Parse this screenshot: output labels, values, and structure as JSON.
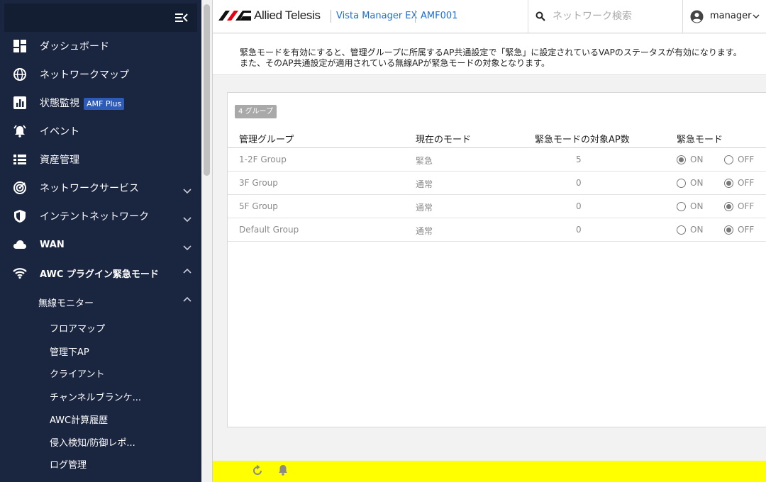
{
  "app": {
    "brand": "Allied Telesis",
    "product": "Vista Manager EX",
    "device": "AMF001"
  },
  "search": {
    "placeholder": "ネットワーク検索"
  },
  "user": {
    "name": "manager"
  },
  "sidebar": {
    "items": [
      {
        "label": "ダッシュボード",
        "icon": "dashboard-icon"
      },
      {
        "label": "ネットワークマップ",
        "icon": "globe-icon"
      },
      {
        "label": "状態監視",
        "icon": "chart-icon",
        "badge": "AMF Plus"
      },
      {
        "label": "イベント",
        "icon": "alarm-icon"
      },
      {
        "label": "資産管理",
        "icon": "list-icon"
      },
      {
        "label": "ネットワークサービス",
        "icon": "radar-icon",
        "expand": "down"
      },
      {
        "label": "インテントネットワーク",
        "icon": "shield-icon",
        "expand": "down"
      },
      {
        "label": "WAN",
        "icon": "cloud-icon",
        "expand": "down"
      },
      {
        "label": "AWC プラグイン緊急モード",
        "icon": "wifi-icon",
        "expand": "up"
      }
    ],
    "submenu": {
      "label": "無線モニター",
      "expand": "up"
    },
    "leaves": [
      "フロアマップ",
      "管理下AP",
      "クライアント",
      "チャンネルブランケ...",
      "AWC計算履歴",
      "侵入検知/防御レポ...",
      "ログ管理"
    ]
  },
  "info": {
    "line1": "緊急モードを有効にすると、管理グループに所属するAP共通設定で「緊急」に設定されているVAPのステータスが有効になります。",
    "line2": "また、そのAP共通設定が適用されている無線APが緊急モードの対象となります。"
  },
  "table": {
    "group_count": "4 グループ",
    "headers": [
      "管理グループ",
      "現在のモード",
      "緊急モードの対象AP数",
      "緊急モード"
    ],
    "on_label": "ON",
    "off_label": "OFF",
    "rows": [
      {
        "group": "1-2F Group",
        "mode": "緊急",
        "ap_count": "5",
        "emergency": "ON"
      },
      {
        "group": "3F Group",
        "mode": "通常",
        "ap_count": "0",
        "emergency": "OFF"
      },
      {
        "group": "5F Group",
        "mode": "通常",
        "ap_count": "0",
        "emergency": "OFF"
      },
      {
        "group": "Default Group",
        "mode": "通常",
        "ap_count": "0",
        "emergency": "OFF"
      }
    ]
  },
  "colors": {
    "sidebar_bg": "#1a2540",
    "accent": "#1c6fd1",
    "footer": "#ffff00",
    "badge": "#2d5bb8"
  }
}
